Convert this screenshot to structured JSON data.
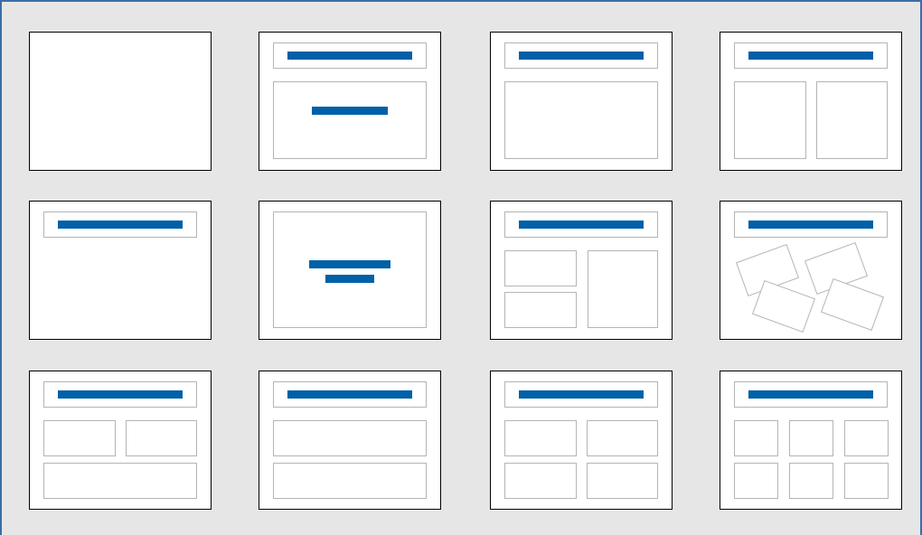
{
  "panel": {
    "accent_color": "#0060a8",
    "frame_color": "#3a6ea5",
    "background_color": "#e6e6e6",
    "placeholder_border_color": "#b4b4b4"
  },
  "layouts": [
    {
      "key": "blank-slide"
    },
    {
      "key": "title-slide"
    },
    {
      "key": "title-content"
    },
    {
      "key": "title-2-content"
    },
    {
      "key": "title-only"
    },
    {
      "key": "centered-text"
    },
    {
      "key": "title-2-content-and-content"
    },
    {
      "key": "title-4-content-tilted"
    },
    {
      "key": "title-2-content-over-content"
    },
    {
      "key": "title-content-over-content"
    },
    {
      "key": "title-4-content"
    },
    {
      "key": "title-6-content"
    }
  ]
}
